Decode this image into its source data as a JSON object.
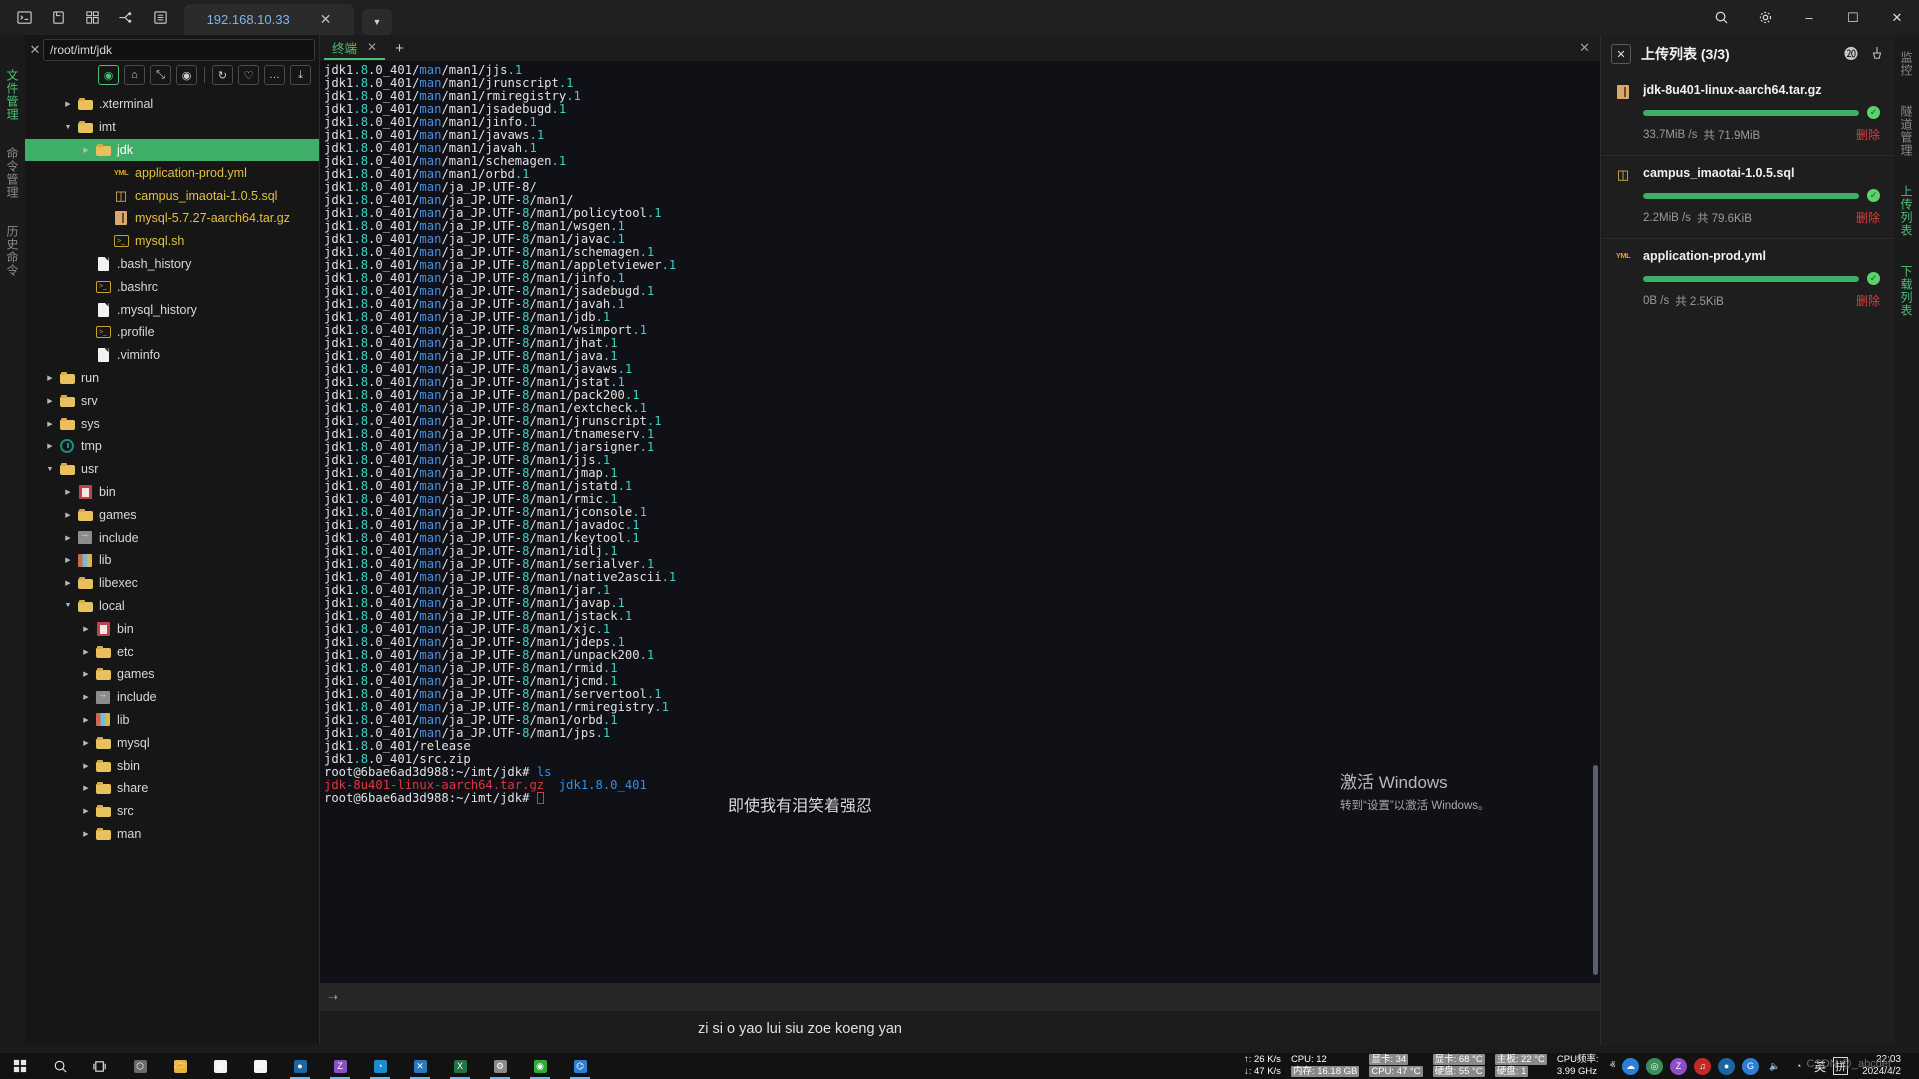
{
  "window": {
    "toolbar_icons": [
      "terminal-icon",
      "file-icon",
      "grid-icon",
      "tunnel-icon",
      "server-list-icon"
    ],
    "tab_title": "192.168.10.33",
    "tab_close": "✕",
    "tab_dropdown": "▼",
    "right_buttons": {
      "search": "⌕",
      "settings": "⚙",
      "minimize": "–",
      "maximize": "☐",
      "close": "✕"
    }
  },
  "left_rail": {
    "tabs": [
      {
        "label": "文件管理",
        "active": true
      },
      {
        "label": "命令管理",
        "active": false
      },
      {
        "label": "历史命令",
        "active": false
      }
    ]
  },
  "file_panel": {
    "path_value": "/root/imt/jdk",
    "path_placeholder": "/root",
    "close_label": "✕",
    "toolbar": [
      {
        "name": "locate-icon",
        "glyph": "◉",
        "accent": true
      },
      {
        "name": "home-icon",
        "glyph": "⌂",
        "accent": false
      },
      {
        "name": "expand-icon",
        "glyph": "⤡",
        "accent": false
      },
      {
        "name": "eye-icon",
        "glyph": "◉",
        "accent": false
      },
      {
        "name": "refresh-icon",
        "glyph": "↻",
        "accent": false
      },
      {
        "name": "favorite-icon",
        "glyph": "♡",
        "accent": false
      },
      {
        "name": "more-icon",
        "glyph": "…",
        "accent": false
      },
      {
        "name": "upload-icon",
        "glyph": "⤓",
        "accent": false
      }
    ],
    "tree": [
      {
        "label": ".xterminal",
        "indent": 2,
        "caret": "right",
        "icon": "folder",
        "cls": ""
      },
      {
        "label": "imt",
        "indent": 2,
        "caret": "down",
        "icon": "folder",
        "cls": ""
      },
      {
        "label": "jdk",
        "indent": 3,
        "caret": "right",
        "icon": "folder",
        "cls": "",
        "selected": true
      },
      {
        "label": "application-prod.yml",
        "indent": 4,
        "caret": "none",
        "icon": "yml",
        "cls": "yml"
      },
      {
        "label": "campus_imaotai-1.0.5.sql",
        "indent": 4,
        "caret": "none",
        "icon": "db",
        "cls": "sql"
      },
      {
        "label": "mysql-5.7.27-aarch64.tar.gz",
        "indent": 4,
        "caret": "none",
        "icon": "tar",
        "cls": "tgz"
      },
      {
        "label": "mysql.sh",
        "indent": 4,
        "caret": "none",
        "icon": "sh",
        "cls": "sh"
      },
      {
        "label": ".bash_history",
        "indent": 3,
        "caret": "none",
        "icon": "doc",
        "cls": ""
      },
      {
        "label": ".bashrc",
        "indent": 3,
        "caret": "none",
        "icon": "sh",
        "cls": ""
      },
      {
        "label": ".mysql_history",
        "indent": 3,
        "caret": "none",
        "icon": "doc",
        "cls": ""
      },
      {
        "label": ".profile",
        "indent": 3,
        "caret": "none",
        "icon": "sh",
        "cls": ""
      },
      {
        "label": ".viminfo",
        "indent": 3,
        "caret": "none",
        "icon": "doc",
        "cls": ""
      },
      {
        "label": "run",
        "indent": 1,
        "caret": "right",
        "icon": "folder",
        "cls": ""
      },
      {
        "label": "srv",
        "indent": 1,
        "caret": "right",
        "icon": "folder",
        "cls": ""
      },
      {
        "label": "sys",
        "indent": 1,
        "caret": "right",
        "icon": "folder",
        "cls": ""
      },
      {
        "label": "tmp",
        "indent": 1,
        "caret": "right",
        "icon": "tmp",
        "cls": ""
      },
      {
        "label": "usr",
        "indent": 1,
        "caret": "down",
        "icon": "folder",
        "cls": ""
      },
      {
        "label": "bin",
        "indent": 2,
        "caret": "right",
        "icon": "bin",
        "cls": ""
      },
      {
        "label": "games",
        "indent": 2,
        "caret": "right",
        "icon": "folder",
        "cls": ""
      },
      {
        "label": "include",
        "indent": 2,
        "caret": "right",
        "icon": "inc",
        "cls": ""
      },
      {
        "label": "lib",
        "indent": 2,
        "caret": "right",
        "icon": "lib",
        "cls": ""
      },
      {
        "label": "libexec",
        "indent": 2,
        "caret": "right",
        "icon": "folder",
        "cls": ""
      },
      {
        "label": "local",
        "indent": 2,
        "caret": "down",
        "icon": "folder",
        "cls": ""
      },
      {
        "label": "bin",
        "indent": 3,
        "caret": "right",
        "icon": "bin",
        "cls": ""
      },
      {
        "label": "etc",
        "indent": 3,
        "caret": "right",
        "icon": "folder",
        "cls": ""
      },
      {
        "label": "games",
        "indent": 3,
        "caret": "right",
        "icon": "folder",
        "cls": ""
      },
      {
        "label": "include",
        "indent": 3,
        "caret": "right",
        "icon": "inc",
        "cls": ""
      },
      {
        "label": "lib",
        "indent": 3,
        "caret": "right",
        "icon": "lib",
        "cls": ""
      },
      {
        "label": "mysql",
        "indent": 3,
        "caret": "right",
        "icon": "folder",
        "cls": ""
      },
      {
        "label": "sbin",
        "indent": 3,
        "caret": "right",
        "icon": "folder",
        "cls": ""
      },
      {
        "label": "share",
        "indent": 3,
        "caret": "right",
        "icon": "folder",
        "cls": ""
      },
      {
        "label": "src",
        "indent": 3,
        "caret": "right",
        "icon": "folder",
        "cls": ""
      },
      {
        "label": "man",
        "indent": 3,
        "caret": "right",
        "icon": "folder",
        "cls": ""
      }
    ]
  },
  "terminal": {
    "tab_label": "终端",
    "tab_close": "✕",
    "add_tab": "+",
    "close_all": "✕",
    "status_icon": "terminal-prompt-icon",
    "prefix": "jdk1.8.0_401/",
    "man1_files": [
      "jjs.1",
      "jrunscript.1",
      "rmiregistry.1",
      "jsadebugd.1",
      "jinfo.1",
      "javaws.1",
      "javah.1",
      "schemagen.1",
      "orbd.1"
    ],
    "ja_dir_line": "ja_JP.UTF-8/",
    "ja_man1_dir_line": "ja_JP.UTF-8/man1/",
    "ja_files": [
      "policytool.1",
      "wsgen.1",
      "javac.1",
      "schemagen.1",
      "appletviewer.1",
      "jinfo.1",
      "jsadebugd.1",
      "javah.1",
      "jdb.1",
      "wsimport.1",
      "jhat.1",
      "java.1",
      "javaws.1",
      "jstat.1",
      "pack200.1",
      "extcheck.1",
      "jrunscript.1",
      "tnameserv.1",
      "jarsigner.1",
      "jjs.1",
      "jmap.1",
      "jstatd.1",
      "rmic.1",
      "jconsole.1",
      "javadoc.1",
      "keytool.1",
      "idlj.1",
      "serialver.1",
      "native2ascii.1",
      "jar.1",
      "javap.1",
      "jstack.1",
      "xjc.1",
      "jdeps.1",
      "unpack200.1",
      "rmid.1",
      "jcmd.1",
      "servertool.1",
      "rmiregistry.1",
      "orbd.1",
      "jps.1"
    ],
    "tail_lines": [
      "jdk1.8.0_401/release",
      "jdk1.8.0_401/src.zip"
    ],
    "prompt": "root@6bae6ad3d988:~/imt/jdk# ",
    "command": "ls",
    "ls_output_file": "jdk-8u401-linux-aarch64.tar.gz",
    "ls_output_dir": "jdk1.8.0_401",
    "prompt_last": "root@6bae6ad3d988:~/imt/jdk# "
  },
  "upload_panel": {
    "close_label": "✕",
    "title": "上传列表 (3/3)",
    "pause_icon": "pause-circle-icon",
    "clear_icon": "broom-icon",
    "pause_glyph": "⓴",
    "clear_glyph": "☒",
    "delete_label": "删除",
    "done_glyph": "✓",
    "items": [
      {
        "name": "jdk-8u401-linux-aarch64.tar.gz",
        "icon": "archive-icon",
        "progress": 100,
        "speed": "33.7MiB /s",
        "total": "共 71.9MiB"
      },
      {
        "name": "campus_imaotai-1.0.5.sql",
        "icon": "database-icon",
        "progress": 100,
        "speed": "2.2MiB /s",
        "total": "共 79.6KiB"
      },
      {
        "name": "application-prod.yml",
        "icon": "yaml-icon",
        "progress": 100,
        "speed": "0B /s",
        "total": "共 2.5KiB"
      }
    ]
  },
  "right_rail": {
    "tabs": [
      {
        "label": "监控",
        "active": false
      },
      {
        "label": "隧道管理",
        "active": false
      },
      {
        "label": "上传列表",
        "active": true
      },
      {
        "label": "下载列表",
        "active": false
      }
    ]
  },
  "watermark": {
    "line1": "激活 Windows",
    "line2": "转到“设置”以激活 Windows。"
  },
  "subtitle": {
    "line1": "即使我有泪笑着强忍",
    "line2": "zi si o yao lui siu zoe koeng yan"
  },
  "taskbar": {
    "start_icon": "windows-start-icon",
    "search_icon": "search-icon",
    "taskview_icon": "task-view-icon",
    "apps": [
      {
        "name": "unity-hub-app",
        "glyph": "⬡",
        "color": "#6a6a6a"
      },
      {
        "name": "file-explorer-app",
        "glyph": "🗁",
        "color": "#e5b23c"
      },
      {
        "name": "microsoft-store-app",
        "glyph": "⊞",
        "color": "#f2f2f2"
      },
      {
        "name": "mail-app",
        "glyph": "✉",
        "color": "#f5f5f5"
      },
      {
        "name": "steam-app",
        "glyph": "●",
        "color": "#1b65a0"
      },
      {
        "name": "zotero-app",
        "glyph": "Z",
        "color": "#8b4fc8"
      },
      {
        "name": "edge-app",
        "glyph": "◔",
        "color": "#1b8bd0"
      },
      {
        "name": "vscode-app",
        "glyph": "✕",
        "color": "#2879c0"
      },
      {
        "name": "excel-app",
        "glyph": "X",
        "color": "#217346"
      },
      {
        "name": "settings-app",
        "glyph": "⚙",
        "color": "#8a8a8a"
      },
      {
        "name": "wechat-app",
        "glyph": "◉",
        "color": "#2aae3a"
      },
      {
        "name": "xterminal-app",
        "glyph": "⌬",
        "color": "#2b7fd4"
      }
    ],
    "monitor": {
      "up_label": "↑: 26 K/s",
      "down_label": "↓: 47 K/s",
      "cpu_usage": "CPU: 12",
      "mem": "内存: 16.18 GB",
      "gpu_usage": "显卡: 34",
      "cpu_temp": "CPU: 47 °C",
      "gpu_temp": "显卡: 68 °C",
      "disk_temp": "硬盘: 55 °C",
      "board_temp": "主板: 22 °C",
      "disk_usage": "硬盘: 1",
      "cpu_freq_label": "CPU频率:",
      "cpu_freq_value": "3.99 GHz"
    },
    "tray": {
      "chevron": "ⱏ",
      "icons": [
        {
          "name": "onedrive-tray-icon",
          "glyph": "☁",
          "color": "#2b7fd4"
        },
        {
          "name": "media-tray-icon",
          "glyph": "◎",
          "color": "#3a8f5a"
        },
        {
          "name": "zotero-tray-icon",
          "glyph": "Z",
          "color": "#8b4fc8"
        },
        {
          "name": "netease-music-tray-icon",
          "glyph": "♫",
          "color": "#c62828"
        },
        {
          "name": "steam-tray-icon",
          "glyph": "●",
          "color": "#1b65a0"
        },
        {
          "name": "gpu-tray-icon",
          "glyph": "G",
          "color": "#2b7fd4"
        },
        {
          "name": "volume-icon",
          "glyph": "🔈",
          "color": "transparent"
        },
        {
          "name": "wifi-icon",
          "glyph": "◔",
          "color": "transparent"
        }
      ],
      "ime_lang": "英",
      "ime_mode": "拼"
    },
    "clock": {
      "time": "22:03",
      "date": "2024/4/2"
    },
    "credit": "CSDN @_abcdef"
  }
}
